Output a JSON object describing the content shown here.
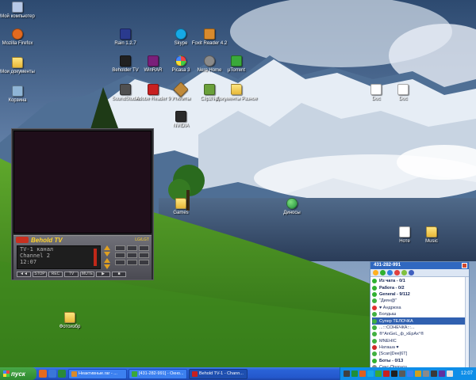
{
  "desktop": {
    "icons": [
      {
        "id": "my-computer",
        "label": "Мой компьютер",
        "color": "#b7c9e8"
      },
      {
        "id": "mozilla",
        "label": "Mozilla Firefox",
        "color": "#e46a1f"
      },
      {
        "id": "my-documents",
        "label": "Мои документы",
        "color": "#ffd866"
      },
      {
        "id": "recycle-bin",
        "label": "Корзина",
        "color": "#8fb5d6"
      },
      {
        "id": "rainlendar",
        "label": "Rain 1.2.7",
        "color": "#2a3a8e"
      },
      {
        "id": "skype",
        "label": "Skype",
        "color": "#16a9e6"
      },
      {
        "id": "winamp",
        "label": "Foxit Reader 4.2",
        "color": "#d98a2c"
      },
      {
        "id": "tv-app",
        "label": "Beholder TV",
        "color": "#202020"
      },
      {
        "id": "winrar",
        "label": "WinRAR",
        "color": "#7a1f7a"
      },
      {
        "id": "picasa",
        "label": "Picasa 3",
        "color": "#c83a8a"
      },
      {
        "id": "nero",
        "label": "Nero Home",
        "color": "#8a8a8a"
      },
      {
        "id": "utorrent",
        "label": "µTorrent",
        "color": "#3aa93a"
      },
      {
        "id": "studio",
        "label": "SoundStudio",
        "color": "#505050"
      },
      {
        "id": "adobe",
        "label": "Adobe Reader 9",
        "color": "#c82020"
      },
      {
        "id": "utilities",
        "label": "Утилиты",
        "color": "#c08a3a"
      },
      {
        "id": "key-game",
        "label": "Clip2Net",
        "color": "#6aa03a"
      },
      {
        "id": "docs-folder",
        "label": "Документы Разное",
        "color": "#ffd866"
      },
      {
        "id": "black-app",
        "label": "NVIDIA",
        "color": "#2a2a2a"
      },
      {
        "id": "doc-1",
        "label": "Doc",
        "color": "#ffffff"
      },
      {
        "id": "doc-2",
        "label": "Doc",
        "color": "#ffffff"
      },
      {
        "id": "folder-games",
        "label": "Games",
        "color": "#ffd866"
      },
      {
        "id": "dinos",
        "label": "Диносы",
        "color": "#1f8f3a"
      },
      {
        "id": "text-file",
        "label": "Ноте",
        "color": "#ffffff"
      },
      {
        "id": "folder-music",
        "label": "Music",
        "color": "#ffd866"
      },
      {
        "id": "folder-photo",
        "label": "Фотоизбр",
        "color": "#ffd866"
      }
    ]
  },
  "tv": {
    "title": "Behold TV",
    "brand": "LG/LGT",
    "lcd_lines": [
      "TV-1 канал",
      "Channel 2",
      "12:07"
    ],
    "buttons": [
      "◄◄",
      "STOP",
      "REC",
      "TV",
      "MUTE",
      "▶",
      "■"
    ]
  },
  "icq": {
    "title": "431-282-991",
    "toolbar_colors": [
      "#ffb020",
      "#30b030",
      "#3080e0",
      "#e04040",
      "#80c040",
      "#4060c0"
    ],
    "rows": [
      {
        "text": "Из чата - 0/1",
        "type": "group",
        "color": "#30b030"
      },
      {
        "text": "Работа - 0/2",
        "type": "group",
        "color": "#30b030"
      },
      {
        "text": "General - 9/112",
        "type": "group",
        "color": "#30b030"
      },
      {
        "text": "\"Диян@\"",
        "type": "contact",
        "color": "#40b040"
      },
      {
        "text": "♥ Андрюха",
        "type": "contact",
        "color": "#e03030"
      },
      {
        "text": "Болдыш",
        "type": "contact",
        "color": "#40b040"
      },
      {
        "text": "Супер ТЕЛОЧКА",
        "type": "contact-selected",
        "color": "#40b040"
      },
      {
        "text": "...:::СОНЕЧКА:::...",
        "type": "contact",
        "color": "#40b040"
      },
      {
        "text": "®°AnGeL_ф_xEpAx°®",
        "type": "contact",
        "color": "#40b040"
      },
      {
        "text": "MNEHIC",
        "type": "contact",
        "color": "#40b040"
      },
      {
        "text": "Наташа ♥",
        "type": "contact",
        "color": "#d02828"
      },
      {
        "text": "[Scan]Dee]6T]",
        "type": "contact",
        "color": "#40b040"
      },
      {
        "text": "Боты - 0/13",
        "type": "group",
        "color": "#30b030"
      },
      {
        "text": "Секс-Прогноз",
        "type": "contact",
        "color": "#888888"
      }
    ]
  },
  "taskbar": {
    "start_label": "пуск",
    "quick_colors": [
      "#e46a1f",
      "#3a76d8",
      "#2a8a3a"
    ],
    "tasks": [
      {
        "label": "Неактивные.rar - ...",
        "color": "#d98a2c",
        "active": false
      },
      {
        "label": "[431-282-991] - Окно...",
        "color": "#3aa93a",
        "active": false
      },
      {
        "label": "Behold TV-1 - Chann...",
        "color": "#c82020",
        "active": true
      }
    ],
    "tray_colors": [
      "#404040",
      "#1e8f3a",
      "#e06020",
      "#16a9e6",
      "#3aa93a",
      "#c82020",
      "#202020",
      "#5a5a5a",
      "#3c80f0",
      "#d0a020",
      "#8a8a8a",
      "#3a3a3a",
      "#6030a0",
      "#e0e0e0",
      "#2a63d8"
    ],
    "clock": "12:07"
  }
}
